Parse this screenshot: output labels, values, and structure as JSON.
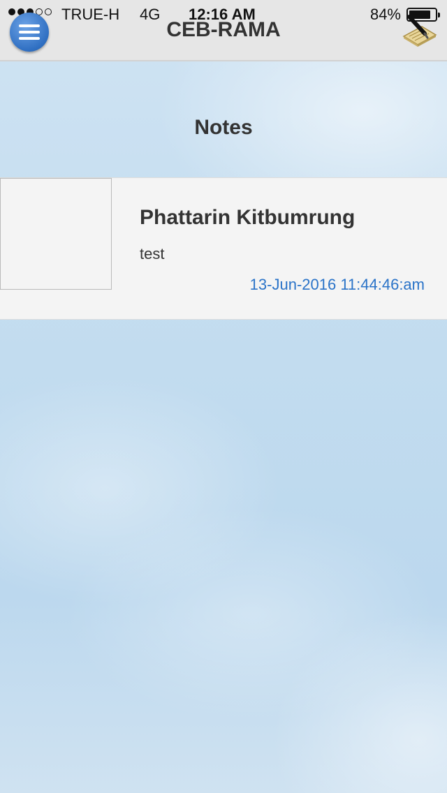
{
  "status_bar": {
    "signal_dots_filled": 3,
    "signal_dots_total": 5,
    "carrier": "TRUE-H",
    "network": "4G",
    "time": "12:16 AM",
    "battery_percent_label": "84%",
    "battery_level": 0.84
  },
  "nav_bar": {
    "title": "CEB-RAMA",
    "menu_icon": "hamburger-menu-icon",
    "compose_icon": "note-pencil-icon"
  },
  "section": {
    "title": "Notes"
  },
  "notes": [
    {
      "author": "Phattarin Kitbumrung",
      "body": "test",
      "timestamp": "13-Jun-2016 11:44:46:am"
    }
  ],
  "colors": {
    "menu_button": "#2f6fc2",
    "timestamp": "#2a73c8",
    "top_bar": "#e6e6e6",
    "card": "#f4f4f4"
  }
}
